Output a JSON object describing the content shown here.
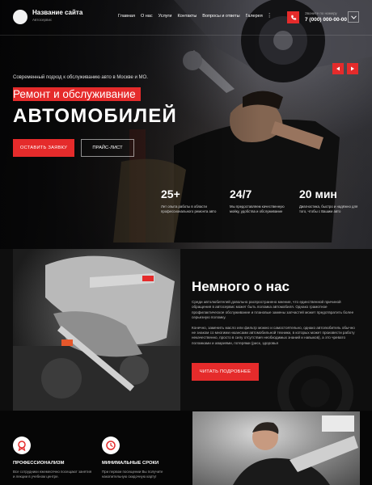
{
  "header": {
    "site_name": "Название сайта",
    "site_tagline": "Автосервис",
    "nav": [
      "Главная",
      "О нас",
      "Услуги",
      "Контакты",
      "Вопросы и ответы",
      "Галерея"
    ],
    "nav_more": "⋮",
    "phone_label": "Звоните по номеру",
    "phone_number": "7 (000) 000-00-00",
    "accent": "#e52b2b"
  },
  "hero": {
    "subtitle": "Современный подход к обслуживанию авто в Москве и МО.",
    "title_line1": "Ремонт и обслуживание",
    "title_line2": "АВТОМОБИЛЕЙ",
    "apply_button": "ОСТАВИТЬ ЗАЯВКУ",
    "price_button": "ПРАЙС-ЛИСТ",
    "stats": [
      {
        "value": "25+",
        "desc": "Лет опыта работы в области профессионального ремонта авто"
      },
      {
        "value": "24/7",
        "desc": "Мы предоставляем качественную мойку, удобства и обслуживание"
      },
      {
        "value": "20 мин",
        "desc": "Диагностика, быстро и надёжно для того, чтобы с Вашим авто"
      }
    ]
  },
  "about": {
    "title": "Немного о нас",
    "paragraphs": [
      "Среди автолюбителей довольно распространено мнение, что единственной причиной обращения в автосервис может быть поломка автомобиля. Однако грамотное профилактическое обслуживание и плановые замены запчастей может предотвратить более серьезную поломку.",
      "Конечно, заменить масло или фильтр можно и самостоятельно, однако автолюбитель обычно не знаком со многими нюансами автомобильной техники, в которых может произвести работу некачественно, просто в силу отсутствия необходимых знаний и навыков), а это чревато поломками и авариями, потерями (риск, здоровья"
    ],
    "more_button": "ЧИТАТЬ ПОДРОБНЕЕ"
  },
  "features": [
    {
      "icon": "certificate-icon",
      "title": "ПРОФЕССИОНАЛИЗМ",
      "desc": "Все сотрудники ежемесячно посещают занятия и лекции в учебном центре."
    },
    {
      "icon": "clock-icon",
      "title": "МИНИМАЛЬНЫЕ СРОКИ",
      "desc": "При первом посещении Вы получите накопительную скидочную карту!"
    }
  ]
}
